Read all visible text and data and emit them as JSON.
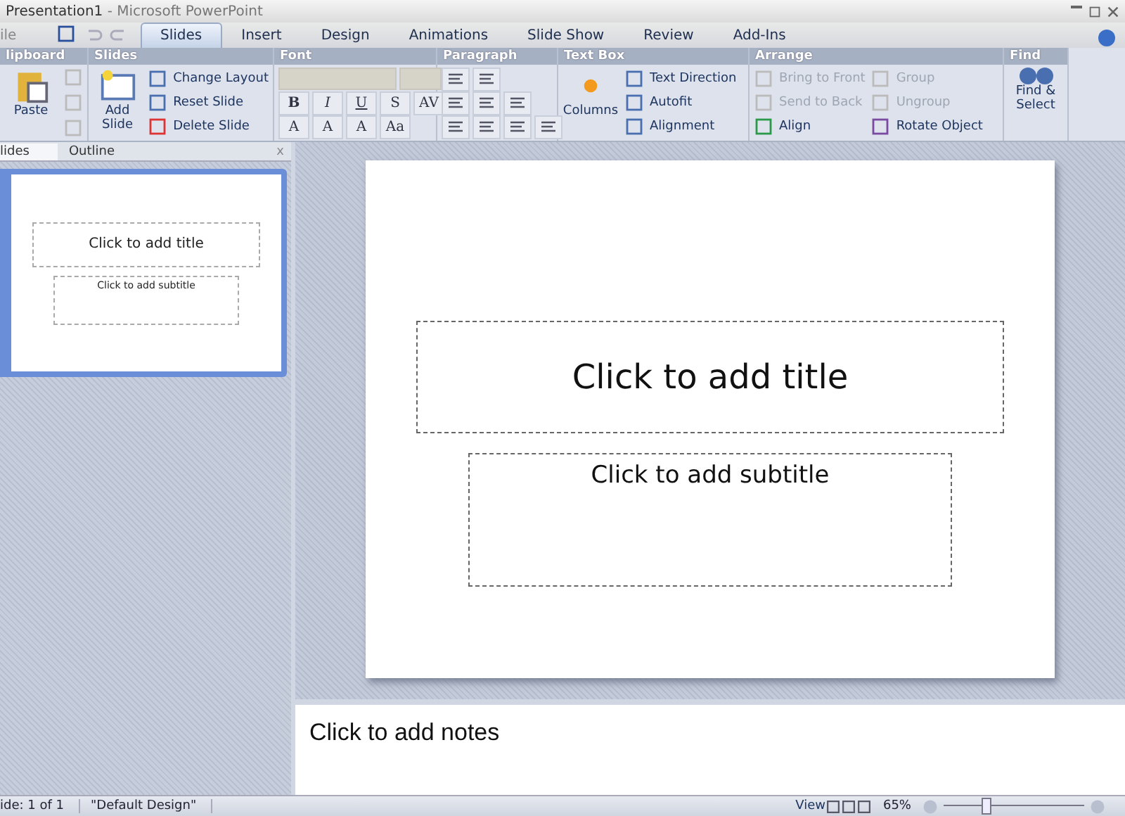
{
  "window": {
    "title": "Presentation1",
    "app": " - Microsoft PowerPoint"
  },
  "file_menu": {
    "label": "ile"
  },
  "tabs": [
    {
      "label": "Slides",
      "selected": true
    },
    {
      "label": "Insert",
      "selected": false
    },
    {
      "label": "Design",
      "selected": false
    },
    {
      "label": "Animations",
      "selected": false
    },
    {
      "label": "Slide Show",
      "selected": false
    },
    {
      "label": "Review",
      "selected": false
    },
    {
      "label": "Add-Ins",
      "selected": false
    }
  ],
  "ribbon": {
    "groups": [
      {
        "kind": "clipboard",
        "title": "lipboard",
        "items": [
          {
            "label": "Paste",
            "disabled": false
          }
        ]
      },
      {
        "kind": "slides",
        "title": "Slides",
        "items": [
          {
            "label": "Add Slide",
            "disabled": false
          },
          {
            "label": "Change Layout",
            "disabled": false
          },
          {
            "label": "Reset Slide",
            "disabled": false
          },
          {
            "label": "Delete Slide",
            "disabled": false
          }
        ]
      },
      {
        "kind": "font",
        "title": "Font",
        "items": [
          {
            "label": "B",
            "disabled": false
          },
          {
            "label": "I",
            "disabled": false
          },
          {
            "label": "U",
            "disabled": false
          },
          {
            "label": "S",
            "disabled": false
          },
          {
            "label": "AV",
            "disabled": false
          },
          {
            "label": "A",
            "disabled": false
          },
          {
            "label": "A",
            "disabled": false
          },
          {
            "label": "A",
            "disabled": false
          },
          {
            "label": "Aa",
            "disabled": false
          }
        ]
      },
      {
        "kind": "paragraph",
        "title": "Paragraph"
      },
      {
        "kind": "textbox",
        "title": "Text Box",
        "items": [
          {
            "label": "Columns",
            "disabled": false
          },
          {
            "label": "Text Direction",
            "disabled": false
          },
          {
            "label": "Autofit",
            "disabled": false
          },
          {
            "label": "Alignment",
            "disabled": false
          }
        ]
      },
      {
        "kind": "arrange",
        "title": "Arrange",
        "items": [
          {
            "label": "Bring to Front",
            "disabled": true
          },
          {
            "label": "Group",
            "disabled": true
          },
          {
            "label": "Send to Back",
            "disabled": true
          },
          {
            "label": "Ungroup",
            "disabled": true
          },
          {
            "label": "Align",
            "disabled": false
          },
          {
            "label": "Rotate Object",
            "disabled": false
          }
        ]
      },
      {
        "kind": "find",
        "title": "Find",
        "items": [
          {
            "label": "Find & Select",
            "disabled": false
          }
        ]
      }
    ]
  },
  "panel": {
    "tabs": [
      {
        "label": "lides",
        "selected": true
      },
      {
        "label": "Outline",
        "selected": false
      }
    ],
    "close": "x",
    "thumbnails": [
      {
        "title": "Click to add title",
        "subtitle": "Click to add subtitle",
        "selected": true
      }
    ]
  },
  "slide": {
    "title_placeholder": "Click to add title",
    "subtitle_placeholder": "Click to add subtitle"
  },
  "notes": {
    "placeholder": "Click to add notes"
  },
  "status_bar": {
    "slide": "ide: 1 of 1",
    "theme": "\"Default Design\"",
    "view": "View",
    "zoom": "65%",
    "level": 0.3
  }
}
